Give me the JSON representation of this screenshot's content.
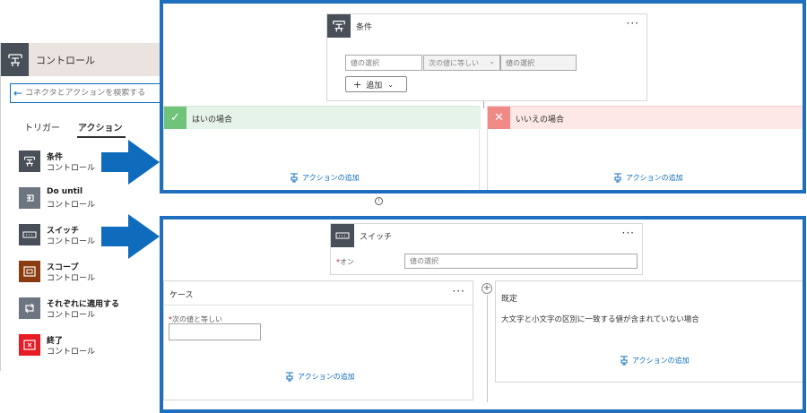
{
  "left_panel": {
    "title": "コントロール",
    "search_placeholder": "コネクタとアクションを検索する",
    "tabs": [
      {
        "label": "トリガー"
      },
      {
        "label": "アクション"
      }
    ],
    "items": [
      {
        "name": "条件",
        "sub": "コントロール",
        "color": "#484f58"
      },
      {
        "name": "Do until",
        "sub": "コントロール",
        "color": "#6c7580"
      },
      {
        "name": "スイッチ",
        "sub": "コントロール",
        "color": "#484f58"
      },
      {
        "name": "スコープ",
        "sub": "コントロール",
        "color": "#8a3b0f"
      },
      {
        "name": "それぞれに適用する",
        "sub": "コントロール",
        "color": "#6c7580"
      },
      {
        "name": "終了",
        "sub": "コントロール",
        "color": "#e81c24"
      }
    ]
  },
  "condition": {
    "title": "条件",
    "more": "···",
    "value1_placeholder": "値の選択",
    "operator": "次の値に等しい",
    "value2_placeholder": "値の選択",
    "add_label": "追加",
    "yes_label": "はいの場合",
    "no_label": "いいえの場合",
    "add_action": "アクションの追加"
  },
  "switch": {
    "title": "スイッチ",
    "more": "···",
    "on_label": "オン",
    "on_placeholder": "値の選択",
    "case_title": "ケース",
    "case_field_label": "次の値と等しい",
    "default_title": "既定",
    "default_desc": "大文字と小文字の区別に一致する値が含まれていない場合",
    "add_action": "アクションの追加"
  },
  "colors": {
    "frame": "#1e6fbd",
    "arrow": "#0f6cbd",
    "yes": "#6fc37a",
    "no": "#f08a86",
    "link": "#0f6cbd"
  }
}
